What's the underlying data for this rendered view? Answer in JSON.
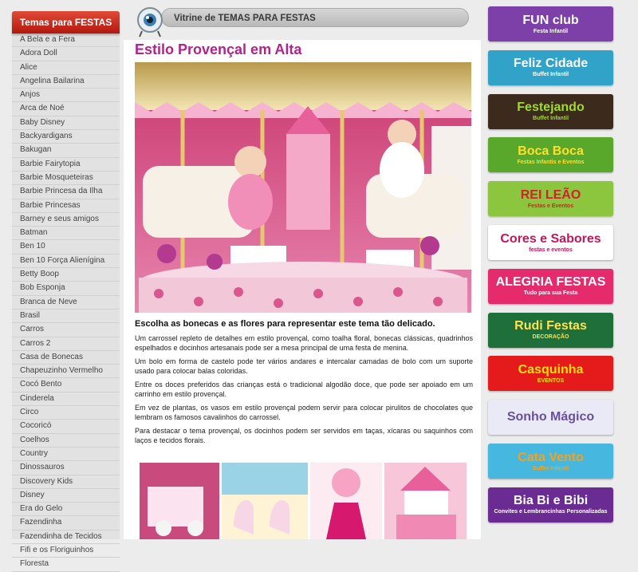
{
  "sidebar": {
    "title": "Temas para FESTAS",
    "items": [
      "A Bela e a Fera",
      "Adora Doll",
      "Alice",
      "Angelina Bailarina",
      "Anjos",
      "Arca de Noé",
      "Baby Disney",
      "Backyardigans",
      "Bakugan",
      "Barbie Fairytopia",
      "Barbie Mosqueteiras",
      "Barbie Princesa da Ilha",
      "Barbie Princesas",
      "Barney e seus amigos",
      "Batman",
      "Ben 10",
      "Ben 10 Força Alienígina",
      "Betty Boop",
      "Bob Esponja",
      "Branca de Neve",
      "Brasil",
      "Carros",
      "Carros 2",
      "Casa de Bonecas",
      "Chapeuzinho Vermelho",
      "Cocó Bento",
      "Cinderela",
      "Circo",
      "Cocoricó",
      "Coelhos",
      "Country",
      "Dinossauros",
      "Discovery Kids",
      "Disney",
      "Era do Gelo",
      "Fazendinha",
      "Fazendinha de Tecidos",
      "Fifi e os Floriguinhos",
      "Floresta"
    ]
  },
  "topbar": {
    "title": "Vitrine de TEMAS PARA FESTAS"
  },
  "article": {
    "title": "Estilo Provençal em Alta",
    "subhead": "Escolha as bonecas e as flores para representar este tema tão delicado.",
    "paragraphs": [
      "Um carrossel repleto de detalhes em estilo provençal, como toalha floral, bonecas clássicas, quadrinhos espelhados e docinhos artesanais pode ser a mesa principal de uma festa de menina.",
      "Um bolo em forma de castelo pode ter vários andares e intercalar camadas de bolo com um suporte usado para colocar balas coloridas.",
      "Entre os doces preferidos das crianças está o tradicional algodão doce, que pode ser apoiado em um carrinho em estilo provençal.",
      "Em vez de plantas, os vasos em estilo provençal podem servir para colocar pirulitos de chocolates que lembram os famosos cavalinhos do carrossel.",
      "Para destacar o tema provençal, os docinhos podem ser servidos em taças, xícaras ou saquinhos com laços e tecidos florais."
    ]
  },
  "banners": [
    {
      "main": "FUN club",
      "sub": "Festa Infantil",
      "bg": "#7d3fa8",
      "fg": "#ffffff"
    },
    {
      "main": "Feliz Cidade",
      "sub": "Buffet Infantil",
      "bg": "#31a3c9",
      "fg": "#ffffff"
    },
    {
      "main": "Festejando",
      "sub": "Buffet Infantil",
      "bg": "#3c2a1c",
      "fg": "#9ddc2b"
    },
    {
      "main": "Boca Boca",
      "sub": "Festas Infantis e Eventos",
      "bg": "#5aa82b",
      "fg": "#ffdf2b"
    },
    {
      "main": "REI LEÃO",
      "sub": "Festas e Eventos",
      "bg": "#8cc63f",
      "fg": "#d3202a"
    },
    {
      "main": "Cores e Sabores",
      "sub": "festas e eventos",
      "bg": "#ffffff",
      "fg": "#c2185b"
    },
    {
      "main": "ALEGRIA FESTAS",
      "sub": "Tudo para sua Festa",
      "bg": "#e52b6c",
      "fg": "#ffffff"
    },
    {
      "main": "Rudi Festas",
      "sub": "DECORAÇÃO",
      "bg": "#1f6f3a",
      "fg": "#ffe14f"
    },
    {
      "main": "Casquinha",
      "sub": "EVENTOS",
      "bg": "#e51b1b",
      "fg": "#ffe100"
    },
    {
      "main": "Sonho Mágico",
      "sub": "",
      "bg": "#e9eaf6",
      "fg": "#6a4fa0"
    },
    {
      "main": "Cata Vento",
      "sub": "Buffet Infantil",
      "bg": "#46b7de",
      "fg": "#f4a21d"
    },
    {
      "main": "Bia Bi e Bibi",
      "sub": "Convites e Lembrancinhas Personalizadas",
      "bg": "#6a2c93",
      "fg": "#ffffff"
    }
  ]
}
